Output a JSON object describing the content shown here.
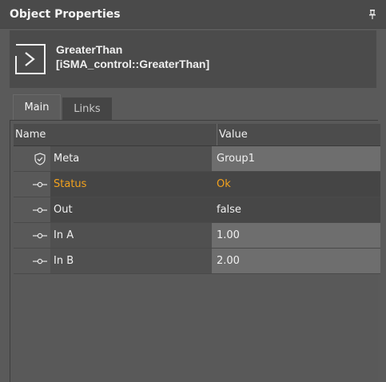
{
  "panel": {
    "title": "Object Properties",
    "pin_icon": "pin-icon"
  },
  "object": {
    "name": "GreaterThan",
    "type": "[iSMA_control::GreaterThan]",
    "icon": "greater-than-icon"
  },
  "tabs": [
    {
      "label": "Main",
      "active": true
    },
    {
      "label": "Links",
      "active": false
    }
  ],
  "table": {
    "columns": {
      "name": "Name",
      "value": "Value"
    },
    "rows": [
      {
        "name": "Meta",
        "value": "Group1",
        "icon": "shield-check-icon"
      },
      {
        "name": "Status",
        "value": "Ok",
        "icon": "slot-icon",
        "highlight": "#f3a21d"
      },
      {
        "name": "Out",
        "value": "false",
        "icon": "slot-icon"
      },
      {
        "name": "In A",
        "value": "1.00",
        "icon": "slot-icon"
      },
      {
        "name": "In B",
        "value": "2.00",
        "icon": "slot-icon"
      }
    ]
  }
}
